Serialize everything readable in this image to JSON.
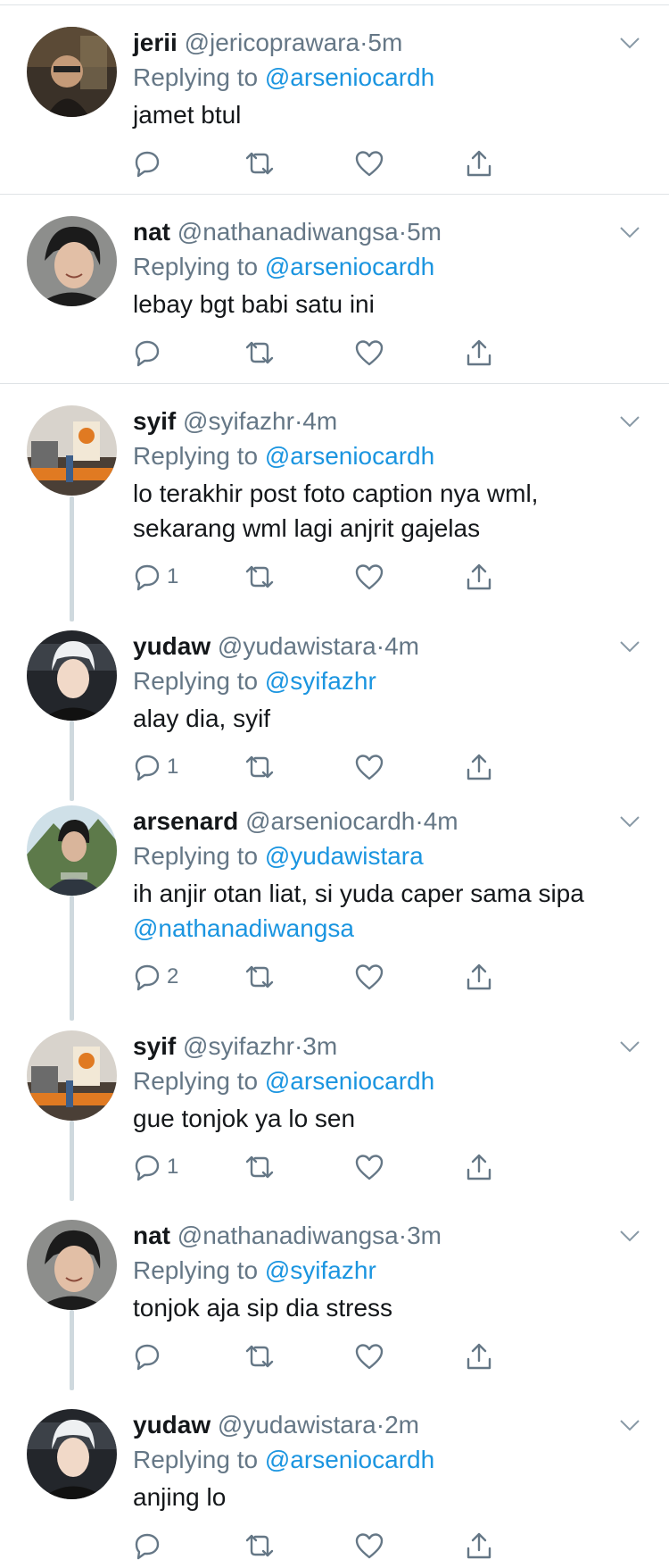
{
  "colors": {
    "link": "#1b95e0",
    "muted": "#657786",
    "text": "#14171a",
    "thread": "#cfd9de"
  },
  "icons": [
    "chevron-down-icon",
    "reply-icon",
    "retweet-icon",
    "heart-icon",
    "share-icon"
  ],
  "tweets": [
    {
      "name": "jerii",
      "handle": "@jericoprawara",
      "sep": "·",
      "time": "5m",
      "replying_prefix": "Replying to",
      "replying_to": "@arseniocardh",
      "text_lines": [
        "jamet btul"
      ],
      "reply_count": ""
    },
    {
      "name": "nat",
      "handle": "@nathanadiwangsa",
      "sep": "·",
      "time": "5m",
      "replying_prefix": "Replying to",
      "replying_to": "@arseniocardh",
      "text_lines": [
        "lebay bgt babi satu ini"
      ],
      "reply_count": ""
    },
    {
      "name": "syif",
      "handle": "@syifazhr",
      "sep": "·",
      "time": "4m",
      "replying_prefix": "Replying to",
      "replying_to": "@arseniocardh",
      "text_lines": [
        "lo terakhir post foto caption nya wml,",
        "sekarang wml lagi anjrit gajelas"
      ],
      "reply_count": "1"
    },
    {
      "name": "yudaw",
      "handle": "@yudawistara",
      "sep": "·",
      "time": "4m",
      "replying_prefix": "Replying to",
      "replying_to": "@syifazhr",
      "text_lines": [
        "alay dia, syif"
      ],
      "reply_count": "1"
    },
    {
      "name": "arsenard",
      "handle": "@arseniocardh",
      "sep": "·",
      "time": "4m",
      "replying_prefix": "Replying to",
      "replying_to": "@yudawistara",
      "text_lines": [
        "ih anjir otan liat, si yuda caper sama sipa"
      ],
      "text_mention": "@nathanadiwangsa",
      "reply_count": "2"
    },
    {
      "name": "syif",
      "handle": "@syifazhr",
      "sep": "·",
      "time": "3m",
      "replying_prefix": "Replying to",
      "replying_to": "@arseniocardh",
      "text_lines": [
        "gue tonjok ya lo sen"
      ],
      "reply_count": "1"
    },
    {
      "name": "nat",
      "handle": "@nathanadiwangsa",
      "sep": "·",
      "time": "3m",
      "replying_prefix": "Replying to",
      "replying_to": "@syifazhr",
      "text_lines": [
        "tonjok aja sip dia stress"
      ],
      "reply_count": ""
    },
    {
      "name": "yudaw",
      "handle": "@yudawistara",
      "sep": "·",
      "time": "2m",
      "replying_prefix": "Replying to",
      "replying_to": "@arseniocardh",
      "text_lines": [
        "anjing lo"
      ],
      "reply_count": ""
    }
  ]
}
